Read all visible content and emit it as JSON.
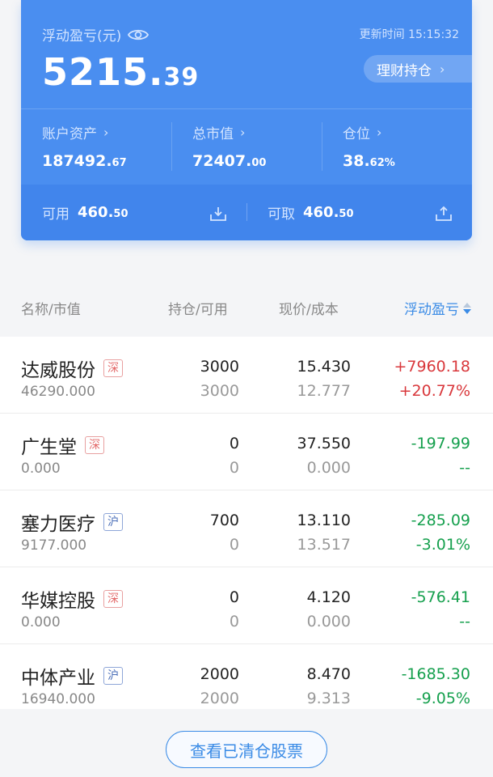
{
  "account": {
    "pl_label": "浮动盈亏(元)",
    "update_label": "更新时间 15:15:32",
    "pl_int": "5215.",
    "pl_dec": "39",
    "manage_label": "理财持仓",
    "stats": [
      {
        "label": "账户资产",
        "int": "187492.",
        "dec": "67"
      },
      {
        "label": "总市值",
        "int": "72407.",
        "dec": "00"
      },
      {
        "label": "仓位",
        "int": "38.",
        "dec": "62%"
      }
    ],
    "available": {
      "label": "可用",
      "int": "460.",
      "dec": "50"
    },
    "withdrawable": {
      "label": "可取",
      "int": "460.",
      "dec": "50"
    }
  },
  "table": {
    "headers": {
      "name": "名称/市值",
      "hold": "持仓/可用",
      "price": "现价/成本",
      "pl": "浮动盈亏"
    },
    "rows": [
      {
        "name": "达威股份",
        "market": "深",
        "mv": "46290.000",
        "hold": "3000",
        "avail": "3000",
        "price": "15.430",
        "cost": "12.777",
        "pl": "+7960.18",
        "pl_pct": "+20.77%",
        "dir": "up"
      },
      {
        "name": "广生堂",
        "market": "深",
        "mv": "0.000",
        "hold": "0",
        "avail": "0",
        "price": "37.550",
        "cost": "0.000",
        "pl": "-197.99",
        "pl_pct": "--",
        "dir": "down"
      },
      {
        "name": "塞力医疗",
        "market": "沪",
        "mv": "9177.000",
        "hold": "700",
        "avail": "0",
        "price": "13.110",
        "cost": "13.517",
        "pl": "-285.09",
        "pl_pct": "-3.01%",
        "dir": "down"
      },
      {
        "name": "华媒控股",
        "market": "深",
        "mv": "0.000",
        "hold": "0",
        "avail": "0",
        "price": "4.120",
        "cost": "0.000",
        "pl": "-576.41",
        "pl_pct": "--",
        "dir": "down"
      },
      {
        "name": "中体产业",
        "market": "沪",
        "mv": "16940.000",
        "hold": "2000",
        "avail": "2000",
        "price": "8.470",
        "cost": "9.313",
        "pl": "-1685.30",
        "pl_pct": "-9.05%",
        "dir": "down"
      }
    ]
  },
  "footer": {
    "cleared_label": "查看已清仓股票"
  },
  "colors": {
    "card_blue": "#4a8ef0",
    "up_red": "#d9383c",
    "down_green": "#16a04e",
    "link_blue": "#3a8be6"
  },
  "icons": {
    "eye": "eye-icon",
    "chevron": "chevron-right-icon",
    "transfer_in": "download-icon",
    "transfer_out": "upload-icon",
    "sort": "sort-icon"
  }
}
